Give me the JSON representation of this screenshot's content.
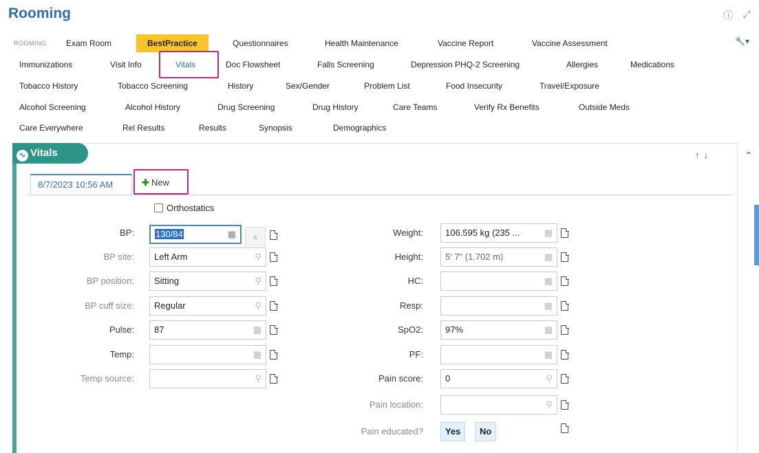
{
  "header": {
    "title": "Rooming",
    "help_icon": "question-circle-icon",
    "expand_icon": "expand-arrows-icon"
  },
  "tabs": {
    "row1": [
      "ROOMING",
      "Exam Room",
      "BestPractice",
      "Questionnaires",
      "Health Maintenance",
      "Vaccine Report",
      "Vaccine Assessment"
    ],
    "row2": [
      "Immunizations",
      "Visit Info",
      "Vitals",
      "Doc Flowsheet",
      "Falls Screening",
      "Depression PHQ-2 Screening",
      "Allergies",
      "Medications"
    ],
    "row3": [
      "Tobacco History",
      "Tobacco Screening",
      "History",
      "Sex/Gender",
      "Problem List",
      "Food Insecurity",
      "Travel/Exposure"
    ],
    "row4": [
      "Alcohol Screening",
      "Alcohol History",
      "Drug Screening",
      "Drug History",
      "Care Teams",
      "Verify Rx Benefits",
      "Outside Meds"
    ],
    "row5": [
      "Care Everywhere",
      "Rel Results",
      "Results",
      "Synopsis",
      "Demographics"
    ],
    "accent_yellow": "#f7c52a"
  },
  "section": {
    "title": "Vitals",
    "accent_color": "#2d9488"
  },
  "entry": {
    "date_tab": "8/7/2023 10:56 AM",
    "new_label": "New",
    "orthostatics_label": "Orthostatics",
    "orthostatics_checked": false
  },
  "left_fields": [
    {
      "label": "BP:",
      "value": "130/84"
    },
    {
      "label": "BP site:",
      "value": "Left Arm"
    },
    {
      "label": "BP position:",
      "value": "Sitting"
    },
    {
      "label": "BP cuff size:",
      "value": "Regular"
    },
    {
      "label": "Pulse:",
      "value": "87"
    },
    {
      "label": "Temp:",
      "value": ""
    },
    {
      "label": "Temp source:",
      "value": ""
    }
  ],
  "right_fields": [
    {
      "label": "Weight:",
      "value": "106.595 kg (235 ..."
    },
    {
      "label": "Height:",
      "value": "5' 7\" (1.702 m)"
    },
    {
      "label": "HC:",
      "value": ""
    },
    {
      "label": "Resp:",
      "value": ""
    },
    {
      "label": "SpO2:",
      "value": "97%"
    },
    {
      "label": "PF:",
      "value": ""
    },
    {
      "label": "Pain score:",
      "value": "0"
    },
    {
      "label": "Pain location:",
      "value": ""
    },
    {
      "label": "Pain educated?",
      "yes": "Yes",
      "no": "No"
    }
  ],
  "highlight_color": "#c0267f"
}
